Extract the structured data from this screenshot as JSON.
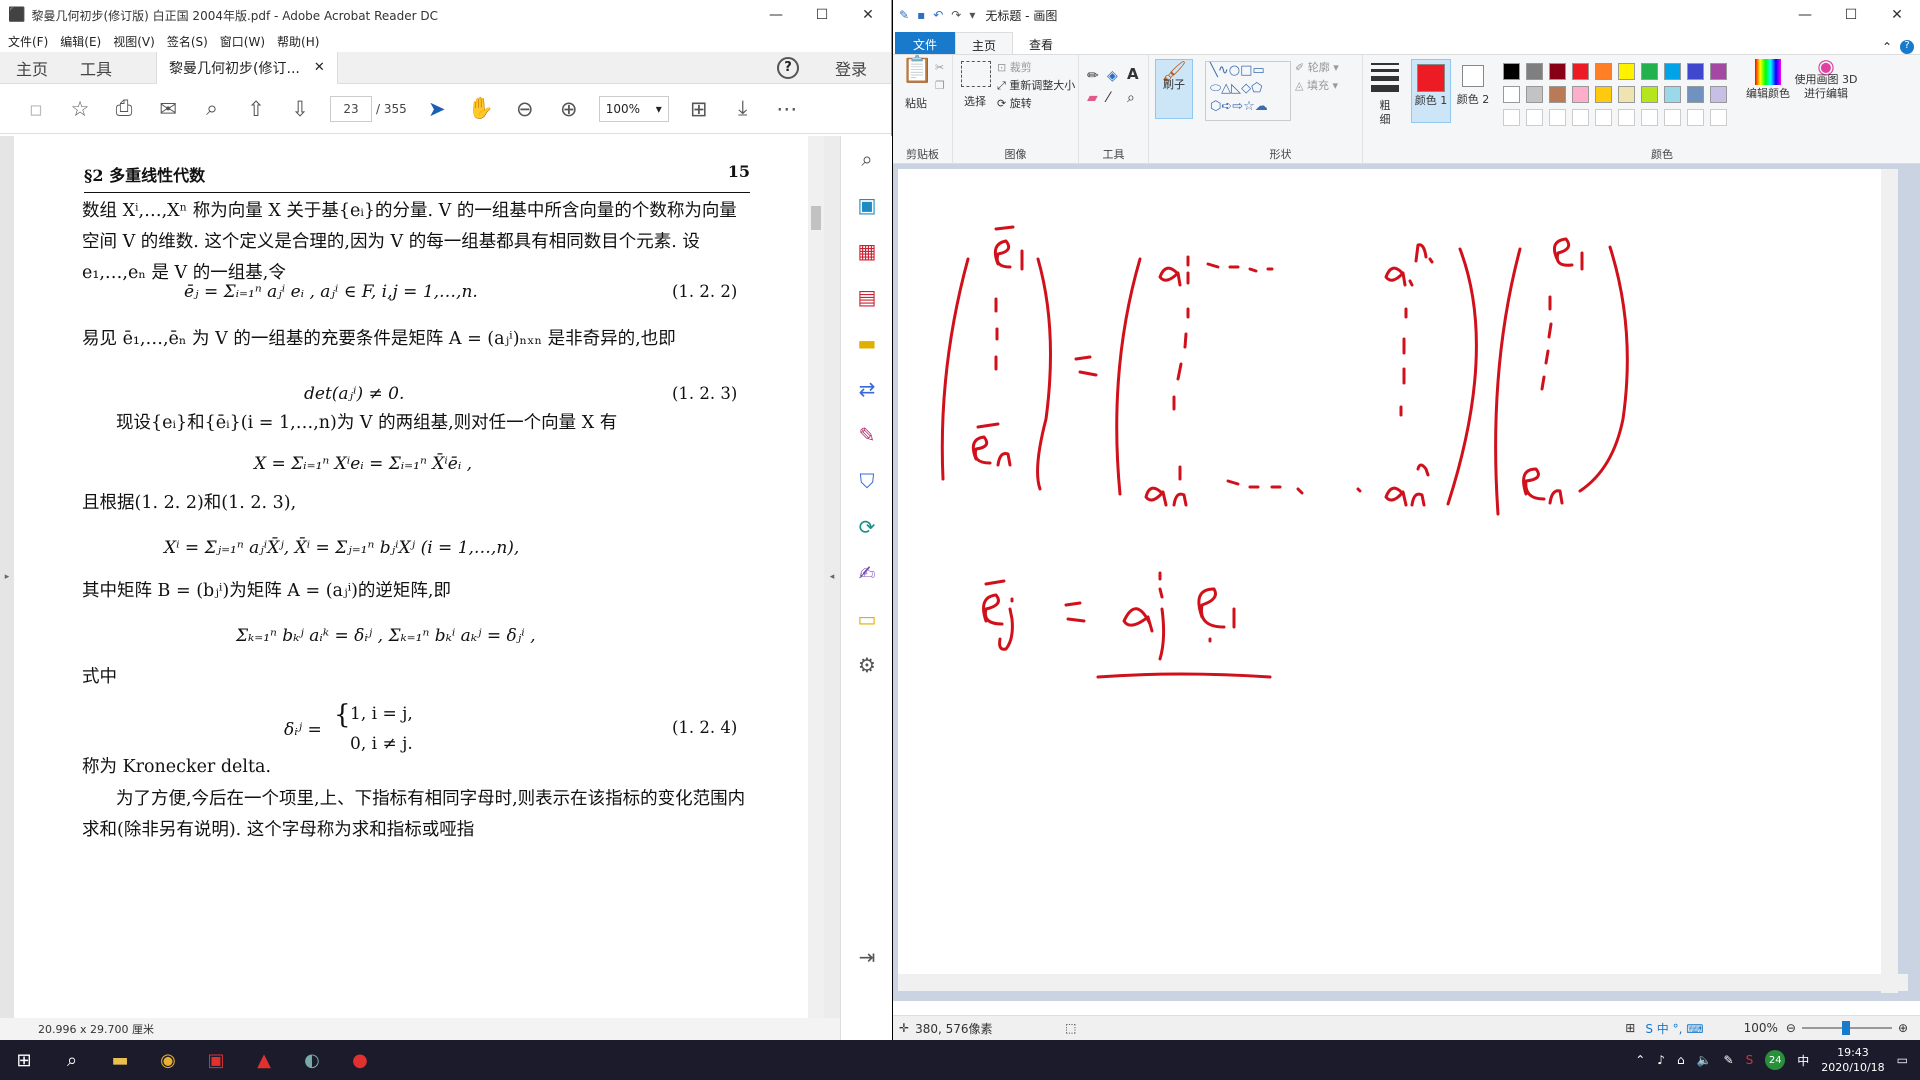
{
  "acrobat": {
    "title": "黎曼几何初步(修订版) 白正国 2004年版.pdf - Adobe Acrobat Reader DC",
    "menu": [
      "文件(F)",
      "编辑(E)",
      "视图(V)",
      "签名(S)",
      "窗口(W)",
      "帮助(H)"
    ],
    "tabs": {
      "home": "主页",
      "tools": "工具",
      "doc": "黎曼几何初步(修订...",
      "login": "登录"
    },
    "page_current": "23",
    "page_total": "/ 355",
    "zoom": "100%",
    "page_size": "20.996 x 29.700 厘米",
    "page": {
      "header_left": "§2   多重线性代数",
      "header_right": "15",
      "p1": "数组 Xⁱ,…,Xⁿ 称为向量 X 关于基{eᵢ}的分量. V 的一组基中所含向量的个数称为向量空间 V 的维数. 这个定义是合理的,因为 V 的每一组基都具有相同数目个元素. 设 e₁,…,eₙ 是 V 的一组基,令",
      "eq1": "ēⱼ  =  Σᵢ₌₁ⁿ aⱼⁱ eᵢ ,     aⱼⁱ ∈ F,     i,j = 1,…,n.",
      "eq1n": "(1. 2. 2)",
      "p2": "易见 ē₁,…,ēₙ 为 V 的一组基的充要条件是矩阵 A = (aⱼⁱ)ₙₓₙ 是非奇异的,也即",
      "eq2": "det(aⱼⁱ) ≠ 0.",
      "eq2n": "(1. 2. 3)",
      "p3": "现设{eᵢ}和{ēᵢ}(i = 1,…,n)为 V 的两组基,则对任一个向量 X 有",
      "eq3": "X  =  Σᵢ₌₁ⁿ Xⁱeᵢ  =  Σᵢ₌₁ⁿ X̄ⁱēᵢ ,",
      "p4": "且根据(1. 2. 2)和(1. 2. 3),",
      "eq4": "Xⁱ  =  Σⱼ₌₁ⁿ aⱼⁱX̄ʲ,     X̄ⁱ  =  Σⱼ₌₁ⁿ bⱼⁱXʲ    (i = 1,…,n),",
      "p5": "其中矩阵 B = (bⱼⁱ)为矩阵 A = (aⱼⁱ)的逆矩阵,即",
      "eq5": "Σₖ₌₁ⁿ bₖʲ aᵢᵏ = δᵢʲ ,      Σₖ₌₁ⁿ bₖⁱ aₖʲ = δⱼⁱ ,",
      "p6": "式中",
      "eq6a": "δᵢʲ =",
      "eq6b": "1,    i = j,",
      "eq6c": "0,    i ≠ j.",
      "eq6n": "(1. 2. 4)",
      "p7": "称为 Kronecker delta.",
      "p8": "为了方便,今后在一个项里,上、下指标有相同字母时,则表示在该指标的变化范围内求和(除非另有说明). 这个字母称为求和指标或哑指"
    }
  },
  "paint": {
    "title": "无标题 - 画图",
    "tabs": {
      "file": "文件",
      "home": "主页",
      "view": "查看"
    },
    "ribbon": {
      "paste": "粘贴",
      "clipboard": "剪贴板",
      "select": "选择",
      "crop": "裁剪",
      "resize": "重新调整大小",
      "rotate": "旋转",
      "image": "图像",
      "tools": "工具",
      "brush": "刷子",
      "shapes": "形状",
      "outline": "轮廓",
      "fill": "填充",
      "size": "粗细",
      "color1": "颜色 1",
      "color2": "颜色 2",
      "edit_colors": "编辑颜色",
      "paint3d": "使用画图 3D 进行编辑",
      "colors": "颜色"
    },
    "status_pos": "380, 576像素",
    "zoom": "100%",
    "palette": [
      "#000000",
      "#7f7f7f",
      "#880015",
      "#ed1c24",
      "#ff7f27",
      "#fff200",
      "#22b14c",
      "#00a2e8",
      "#3f48cc",
      "#a349a4",
      "#ffffff",
      "#c3c3c3",
      "#b97a57",
      "#ffaec9",
      "#ffc90e",
      "#efe4b0",
      "#b5e61d",
      "#99d9ea",
      "#7092be",
      "#c8bfe7"
    ],
    "drawing_color": "#d0101a"
  },
  "taskbar": {
    "time": "19:43",
    "date": "2020/10/18",
    "ime": "中",
    "badge": "24"
  }
}
